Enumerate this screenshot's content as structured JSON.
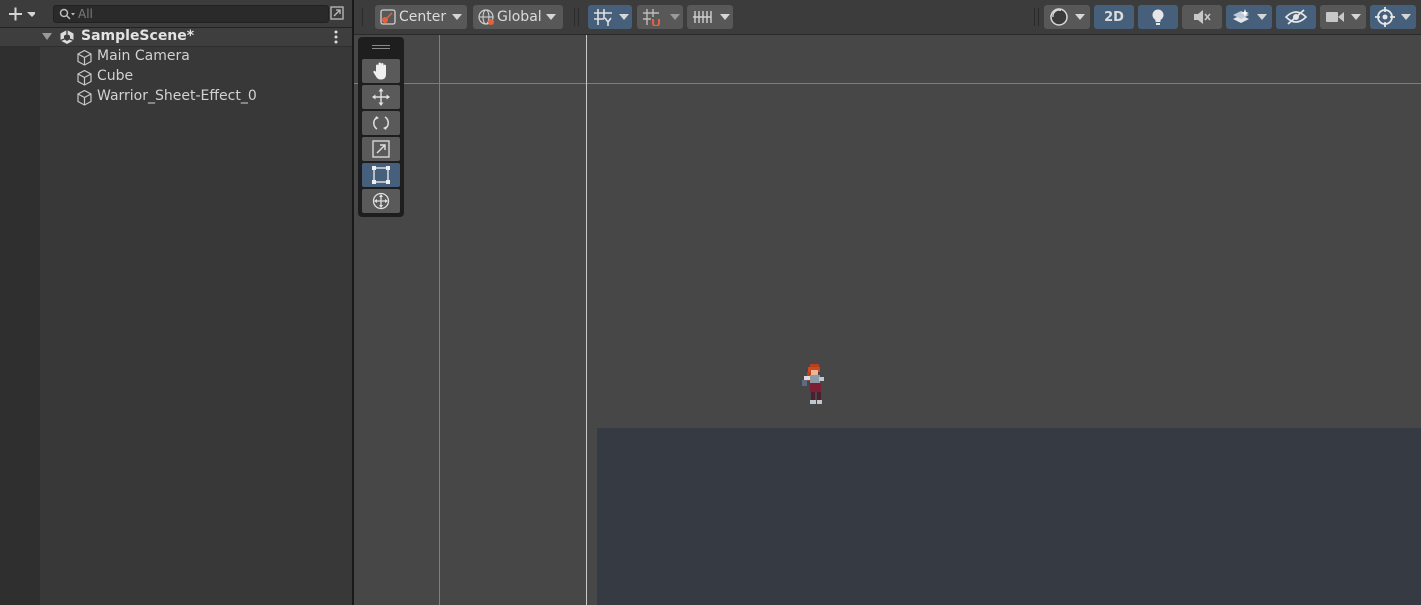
{
  "hierarchy": {
    "search": {
      "placeholder": "All"
    },
    "scene": {
      "name": "SampleScene*"
    },
    "objects": [
      {
        "name": "Main Camera"
      },
      {
        "name": "Cube"
      },
      {
        "name": "Warrior_Sheet-Effect_0"
      }
    ]
  },
  "scene_toolbar": {
    "pivot_mode": "Center",
    "pivot_rotation": "Global",
    "mode_2d_label": "2D"
  },
  "tools": [
    {
      "name": "hand-tool",
      "icon": "hand-icon",
      "selected": false
    },
    {
      "name": "move-tool",
      "icon": "move-arrows-icon",
      "selected": false
    },
    {
      "name": "rotate-tool",
      "icon": "rotate-icon",
      "selected": false
    },
    {
      "name": "scale-tool",
      "icon": "scale-icon",
      "selected": false
    },
    {
      "name": "rect-tool",
      "icon": "rect-transform-icon",
      "selected": true
    },
    {
      "name": "transform-tool",
      "icon": "transform-icon",
      "selected": false
    }
  ],
  "colors": {
    "accent": "#46607c",
    "guide_line": "#1f9bd8",
    "scene_bg": "#474747",
    "ground": "#363a43"
  }
}
